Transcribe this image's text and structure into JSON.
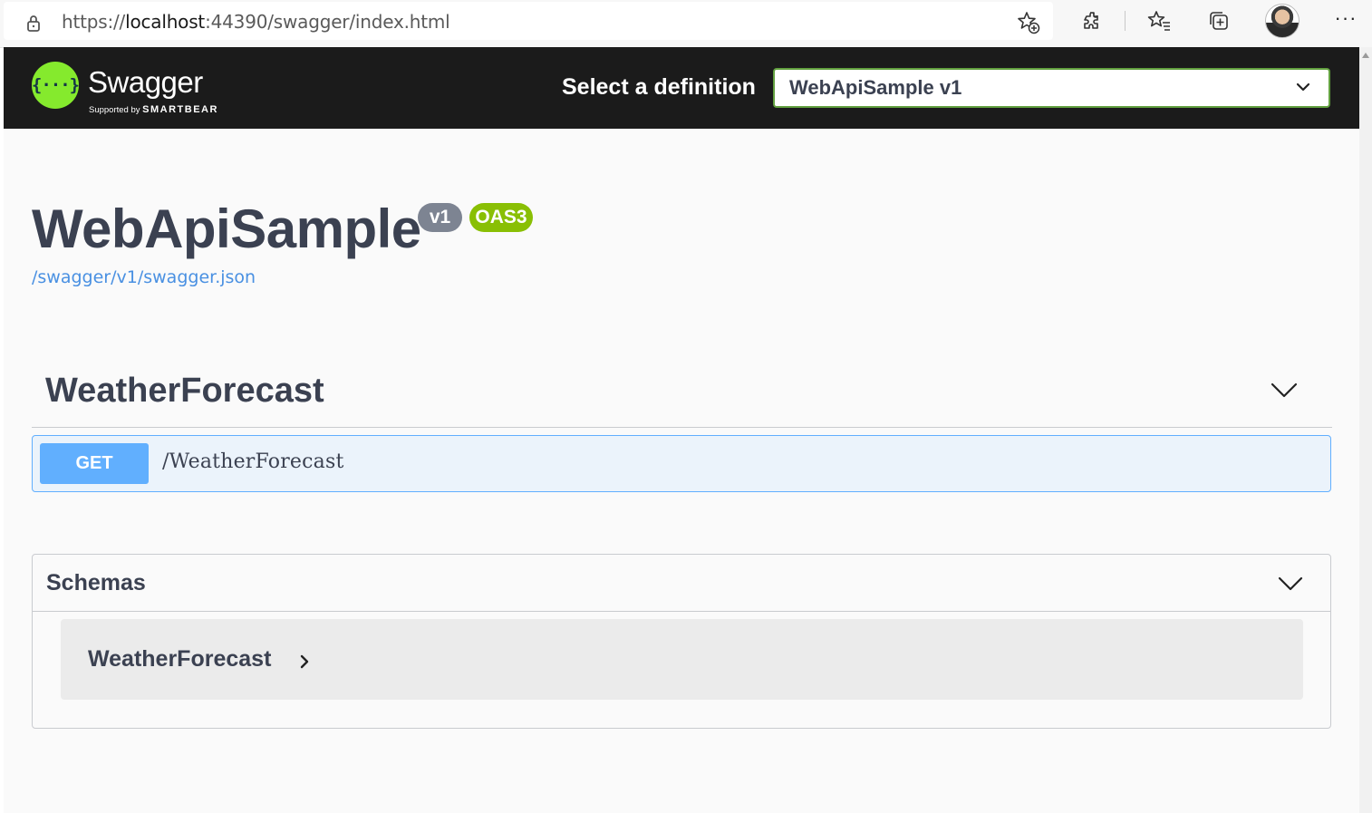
{
  "browser": {
    "url_prefix": "https://",
    "url_host": "localhost",
    "url_rest": ":44390/swagger/index.html",
    "icons": [
      "lock-icon",
      "star-add-icon",
      "extensions-icon",
      "favorites-icon",
      "collections-icon",
      "avatar",
      "more-icon"
    ],
    "more_glyph": "···"
  },
  "topbar": {
    "logo_symbol": "{···}",
    "logo_word": "Swagger",
    "logo_sub_prefix": "Supported by",
    "logo_sub_brand": "SMARTBEAR",
    "select_label": "Select a definition",
    "selected_definition": "WebApiSample v1"
  },
  "info": {
    "title": "WebApiSample",
    "version_badge": "v1",
    "oas_badge": "OAS3",
    "spec_link": "/swagger/v1/swagger.json"
  },
  "tags": [
    {
      "name": "WeatherForecast",
      "operations": [
        {
          "method": "GET",
          "path": "/WeatherForecast"
        }
      ]
    }
  ],
  "schemas": {
    "title": "Schemas",
    "models": [
      "WeatherForecast"
    ]
  },
  "colors": {
    "topbar_bg": "#1b1b1b",
    "logo_green": "#85ea2d",
    "select_border": "#62a03f",
    "get_blue": "#61affe",
    "get_bg": "#ebf3fb",
    "oas_green": "#89bf04",
    "version_gray": "#7d8492",
    "link_blue": "#4990e2",
    "text_dark": "#3b4151"
  }
}
